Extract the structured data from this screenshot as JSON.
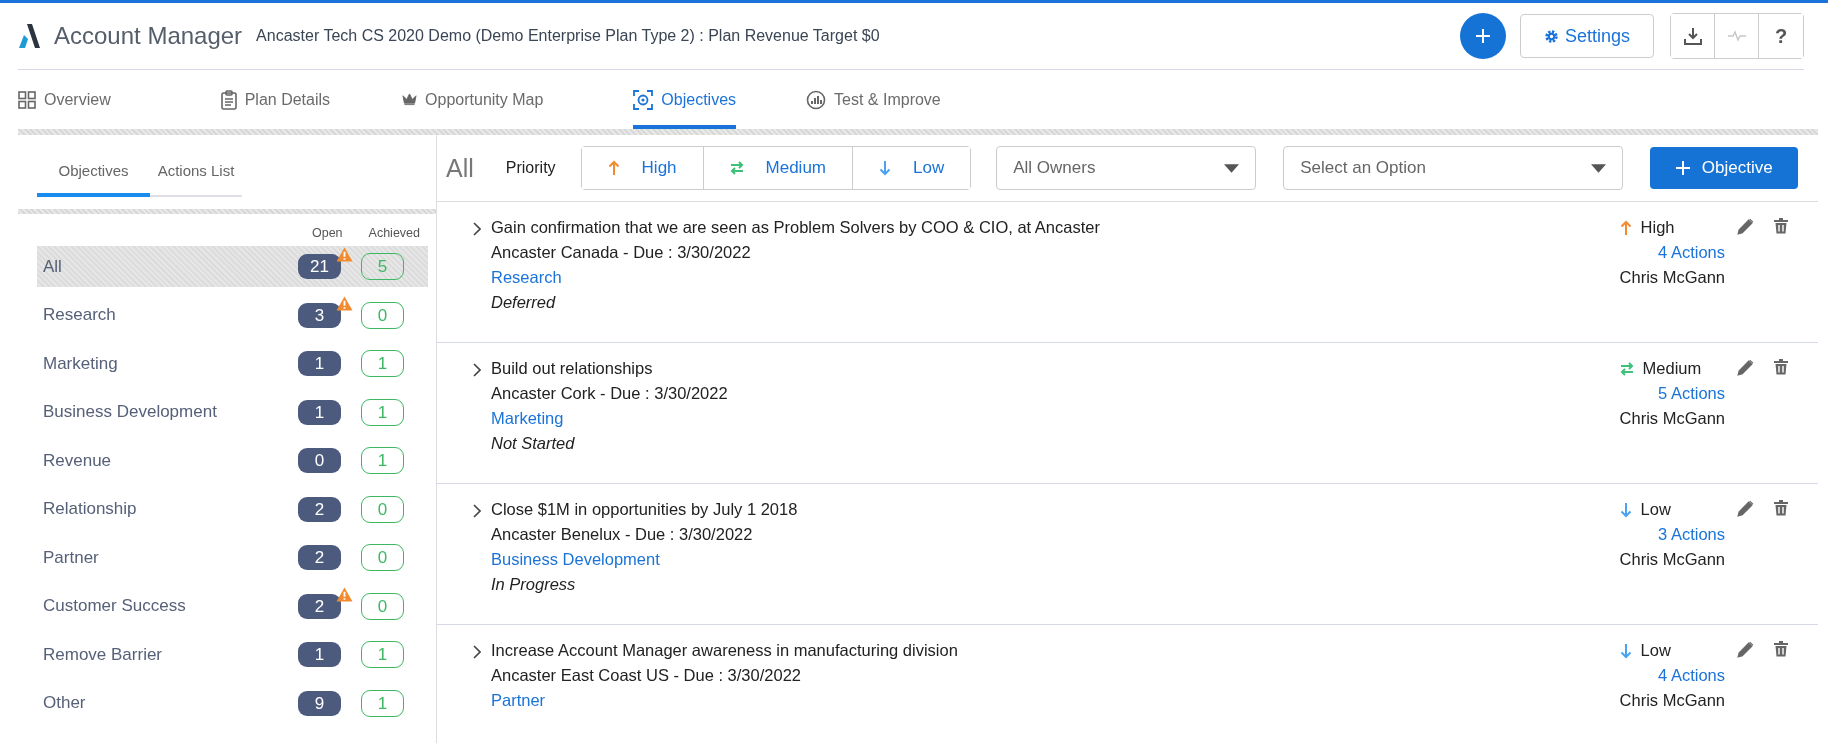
{
  "header": {
    "app_name": "Account Manager",
    "plan_title": "Ancaster Tech CS 2020 Demo (Demo Enterprise Plan Type 2) : Plan Revenue Target $0",
    "settings_label": "Settings",
    "help_label": "?",
    "activity_disabled": true
  },
  "nav_tabs": [
    {
      "label": "Overview",
      "kind": "grid",
      "selected": false
    },
    {
      "label": "Plan Details",
      "kind": "clipboard",
      "selected": false
    },
    {
      "label": "Opportunity Map",
      "kind": "crown",
      "selected": false
    },
    {
      "label": "Objectives",
      "kind": "target",
      "selected": true
    },
    {
      "label": "Test & Improve",
      "kind": "chart",
      "selected": false
    }
  ],
  "side_tabs": [
    {
      "label": "Objectives",
      "selected": true
    },
    {
      "label": "Actions List",
      "selected": false
    }
  ],
  "category_columns": {
    "open": "Open",
    "achieved": "Achieved"
  },
  "categories": [
    {
      "name": "All",
      "open": "21",
      "achieved": "5",
      "warning": true,
      "selected": true
    },
    {
      "name": "Research",
      "open": "3",
      "achieved": "0",
      "warning": true,
      "selected": false
    },
    {
      "name": "Marketing",
      "open": "1",
      "achieved": "1",
      "warning": false,
      "selected": false
    },
    {
      "name": "Business Development",
      "open": "1",
      "achieved": "1",
      "warning": false,
      "selected": false
    },
    {
      "name": "Revenue",
      "open": "0",
      "achieved": "1",
      "warning": false,
      "selected": false
    },
    {
      "name": "Relationship",
      "open": "2",
      "achieved": "0",
      "warning": false,
      "selected": false
    },
    {
      "name": "Partner",
      "open": "2",
      "achieved": "0",
      "warning": false,
      "selected": false
    },
    {
      "name": "Customer Success",
      "open": "2",
      "achieved": "0",
      "warning": true,
      "selected": false
    },
    {
      "name": "Remove Barrier",
      "open": "1",
      "achieved": "1",
      "warning": false,
      "selected": false
    },
    {
      "name": "Other",
      "open": "9",
      "achieved": "1",
      "warning": false,
      "selected": false
    }
  ],
  "filters": {
    "current": "All",
    "priority_label": "Priority",
    "priorities": [
      {
        "label": "High",
        "kind": "high"
      },
      {
        "label": "Medium",
        "kind": "medium"
      },
      {
        "label": "Low",
        "kind": "low"
      }
    ],
    "owner_select": "All Owners",
    "option_select": "Select an Option",
    "add_button": "Objective"
  },
  "objectives": [
    {
      "title": "Gain confirmation that we are seen as Problem Solvers by COO & CIO, at Ancaster",
      "account": "Ancaster Canada",
      "due": "- Due : 3/30/2022",
      "category": "Research",
      "status": "Deferred",
      "priority": "High",
      "kind": "high",
      "actions": "4 Actions",
      "owner": "Chris McGann"
    },
    {
      "title": "Build out relationships",
      "account": "Ancaster Cork",
      "due": "- Due : 3/30/2022",
      "category": "Marketing",
      "status": "Not Started",
      "priority": "Medium",
      "kind": "medium",
      "actions": "5 Actions",
      "owner": "Chris McGann"
    },
    {
      "title": "Close $1M in opportunities by July 1 2018",
      "account": "Ancaster Benelux",
      "due": "- Due : 3/30/2022",
      "category": "Business Development",
      "status": "In Progress",
      "priority": "Low",
      "kind": "low",
      "actions": "3 Actions",
      "owner": "Chris McGann"
    },
    {
      "title": "Increase Account Manager awareness in manufacturing division",
      "account": "Ancaster East Coast US",
      "due": "- Due : 3/30/2022",
      "category": "Partner",
      "priority": "Low",
      "kind": "low",
      "actions": "4 Actions",
      "owner": "Chris McGann"
    }
  ]
}
